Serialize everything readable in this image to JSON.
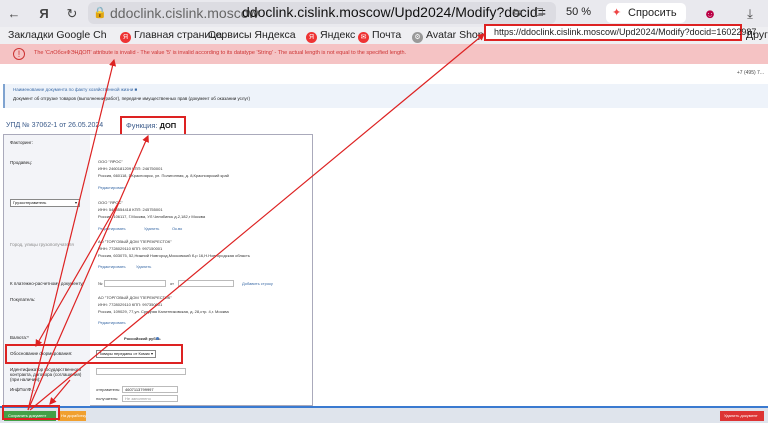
{
  "browser": {
    "domain": "ddoclink.cislink.moscow",
    "url_path": "ddoclink.cislink.moscow/Upd2024/Modify?docid=",
    "zoom": "50 %",
    "ask_label": "Спросить",
    "tooltip_url": "https://ddoclink.cislink.moscow/Upd2024/Modify?docid=16022987",
    "accent": "#d22222"
  },
  "bookmarks": [
    {
      "label": "Закладки Google Ch"
    },
    {
      "label": "Главная страница"
    },
    {
      "label": "Сервисы Яндекса"
    },
    {
      "label": "Яндекс"
    },
    {
      "label": "Почта"
    },
    {
      "label": "Avatar Shop"
    },
    {
      "label": "Другие"
    }
  ],
  "error": {
    "text": "The 'СлОбснФЭНДОП' attribute is invalid - The value '5' is invalid according to its datatype 'String' - The actual length is not equal to the specified length."
  },
  "phone": "+7 (495) 7...",
  "notice": {
    "title": "Наименование документа по факту хозяйственной жизни ■",
    "text": "Документ об отгрузке товаров (выполнении работ), передаче имущественных прав (документ об оказании услуг)"
  },
  "doc": {
    "number": "УПД № 37062-1  от  26.05.2024",
    "function_label": "Функция:",
    "function_value": "ДОП"
  },
  "form": {
    "factoring": "Факторинг:",
    "seller_label": "Продавец:",
    "seller_name": "ООО \"ЯРОС\"",
    "seller_inn": "ИНН: 2460181209 КПП: 246750001",
    "seller_addr": "Россия, 660118, Г.Красноярск, ул. Полигонная, д. 8,Красноярский край",
    "edit": "Редактировать",
    "shipper_select": "Грузоотправитель",
    "shipper_name": "ООО \"ЯРОС\"",
    "shipper_inn": "ИНН: 5493554418 КПП: 245755001",
    "shipper_addr": "Россия, 106117, Г.Москва, УЛ.Челябинск д.2,182,г Москва",
    "delete": "Удалить",
    "add": "Ок.во",
    "consignee_label": "Город, улицы грузополучателя",
    "consignee_name": "АО \"ТОРГОВЫЙ ДОМ \"ПЕРЕКРЕСТОК\"",
    "consignee_inn": "ИНН: 7728029110 КПП: 997150001",
    "consignee_addr": "Россия, 603075, 52,Нижний Новгород,Московский б-р 16,Н.Новгородская область",
    "payment_doc_label": "К платежно-расчетному документу:",
    "payment_no": "№",
    "payment_from": "от",
    "add_row": "Добавить строку",
    "buyer_label": "Покупатель:",
    "buyer_name": "АО \"ТОРГОВЫЙ ДОМ \"ПЕРЕКРЕСТОК\"",
    "buyer_inn": "ИНН: 7728029110 КПП: 997350001",
    "buyer_addr": "Россия, 109029, 77,ул. Средняя Калитниковская, д. 28,стр. 4,г. Москва",
    "currency_label": "Валюта:*",
    "currency_value": "Российский рубль",
    "basis_label": "Обоснование формирования:",
    "basis_value": "Товары переданы от Комис",
    "gov_label": "Идентификатор государственного контракта, договора (соглашения) (при наличии):",
    "info_label": "ИнфПолФ...",
    "sender_label": "отправитель:",
    "sender_value": "4607113799997",
    "recipient_label": "получатель:",
    "recipient_value": "Не заполнено"
  },
  "bottom": {
    "save": "Сохранить документ",
    "draft": "На доработку",
    "delete": "Удалить документ"
  }
}
